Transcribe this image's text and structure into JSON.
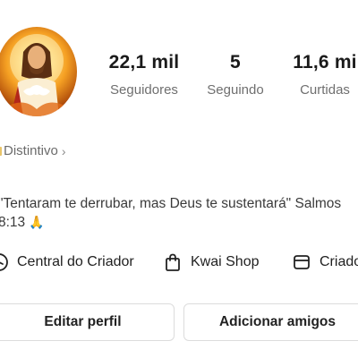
{
  "profile": {
    "stats": [
      {
        "value": "22,1 mil",
        "label": "Seguidores"
      },
      {
        "value": "5",
        "label": "Seguindo"
      },
      {
        "value": "11,6 mi",
        "label": "Curtidas"
      }
    ],
    "badge_label": "Distintivo",
    "bio_line1": "\"Tentaram te derrubar, mas Deus te sustentará\" Salmos",
    "bio_line2": "8:13",
    "quick_links": [
      {
        "label": "Central do Criador",
        "icon": "creator-center-icon"
      },
      {
        "label": "Kwai Shop",
        "icon": "shopping-bag-icon"
      },
      {
        "label": "Criado",
        "icon": "creator-tools-icon"
      }
    ],
    "buttons": {
      "edit": "Editar perfil",
      "add_friends": "Adicionar amigos"
    }
  },
  "colors": {
    "text_primary": "#1f1f1f",
    "text_secondary": "#6f6f6f",
    "button_border": "#dcdcdc"
  }
}
